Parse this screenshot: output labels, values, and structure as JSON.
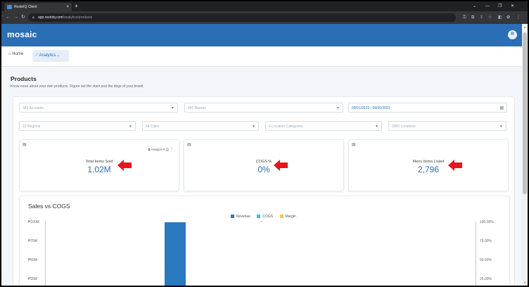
{
  "browser": {
    "tab_title": "ResteIQ Client",
    "tab_close": "×",
    "new_tab": "+",
    "url_host": "app.restoiq.com",
    "url_path": "/analytics/products",
    "window_controls": [
      "⌄",
      "—",
      "❐",
      "✕"
    ]
  },
  "app": {
    "brand": "mosaic",
    "avatar_initial": "R"
  },
  "nav": {
    "home": "Home",
    "analytics": "Analytics"
  },
  "page": {
    "title": "Products",
    "subtitle": "Know more about your own products. Figure out the stars and the dogs of your brand."
  },
  "filters": {
    "accounts": "383 Accounts",
    "brands": "441 Brands",
    "date_range": "09/01/2023 - 09/30/2023",
    "regions": "10 Regions",
    "cities": "64 Cities",
    "location_categories": "4 Location Categories",
    "location_tiers": "2000 Locations"
  },
  "kpis": [
    {
      "label": "Total Items Sold",
      "value": "1.02M",
      "tool_label": "Analyze It"
    },
    {
      "label": "COGS %",
      "value": "0%"
    },
    {
      "label": "Menu Items Listed",
      "value": "2,796"
    }
  ],
  "colors": {
    "header": "#2a6eb5",
    "accent": "#2a6eb5",
    "arrow": "#e8141b",
    "revenue": "#2a78c0",
    "cogs": "#38c7d8",
    "margin": "#f5c842"
  },
  "chart_data": {
    "type": "bar",
    "title": "Sales vs COGS",
    "series": [
      {
        "name": "Revenue",
        "color": "#2a78c0"
      },
      {
        "name": "COGS",
        "color": "#38c7d8"
      },
      {
        "name": "Margin",
        "color": "#f5c842"
      }
    ],
    "y_left_ticks": [
      "₱100M",
      "₱75M",
      "₱50M",
      "₱25M"
    ],
    "y_right_ticks": [
      "100.00%",
      "75.00%",
      "50.00%",
      "25.00%"
    ],
    "ylim": [
      0,
      100
    ],
    "revenue_bar_value": 100
  }
}
